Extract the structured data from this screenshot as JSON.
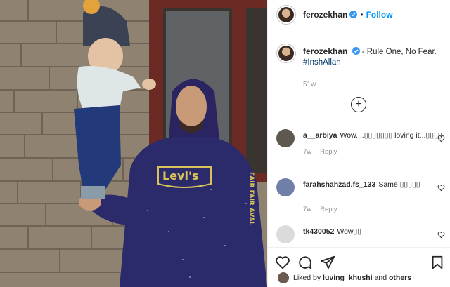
{
  "post": {
    "author": "ferozekhan",
    "follow_label": "Follow",
    "dot": "•",
    "caption_user": "ferozekhan",
    "caption_text": "- Rule One, No Fear.",
    "hashtag": "#InshAllah",
    "age": "51w"
  },
  "comments": [
    {
      "user": "a__arbiya",
      "text": "Wow....▯▯▯▯▯▯▯ loving it...▯▯▯▯",
      "age": "7w",
      "reply": "Reply",
      "avatar_color": "#5f5850"
    },
    {
      "user": "farahshahzad.fs_133",
      "text": "Same ▯▯▯▯▯",
      "age": "7w",
      "reply": "Reply",
      "avatar_color": "#6f7fa8"
    },
    {
      "user": "tk430052",
      "text": "Wow▯▯",
      "avatar_color": "#dbdbdb"
    }
  ],
  "actions": {
    "icons": [
      "heart-icon",
      "comment-icon",
      "share-icon",
      "bookmark-icon"
    ]
  },
  "liked_by": {
    "prefix": "Liked by",
    "user": "luving_khushi",
    "middle": "and",
    "others": "others"
  },
  "photo": {
    "hoodie_brand": "Levi's",
    "sleeve_text": "FAIR FAIR AVAL"
  }
}
